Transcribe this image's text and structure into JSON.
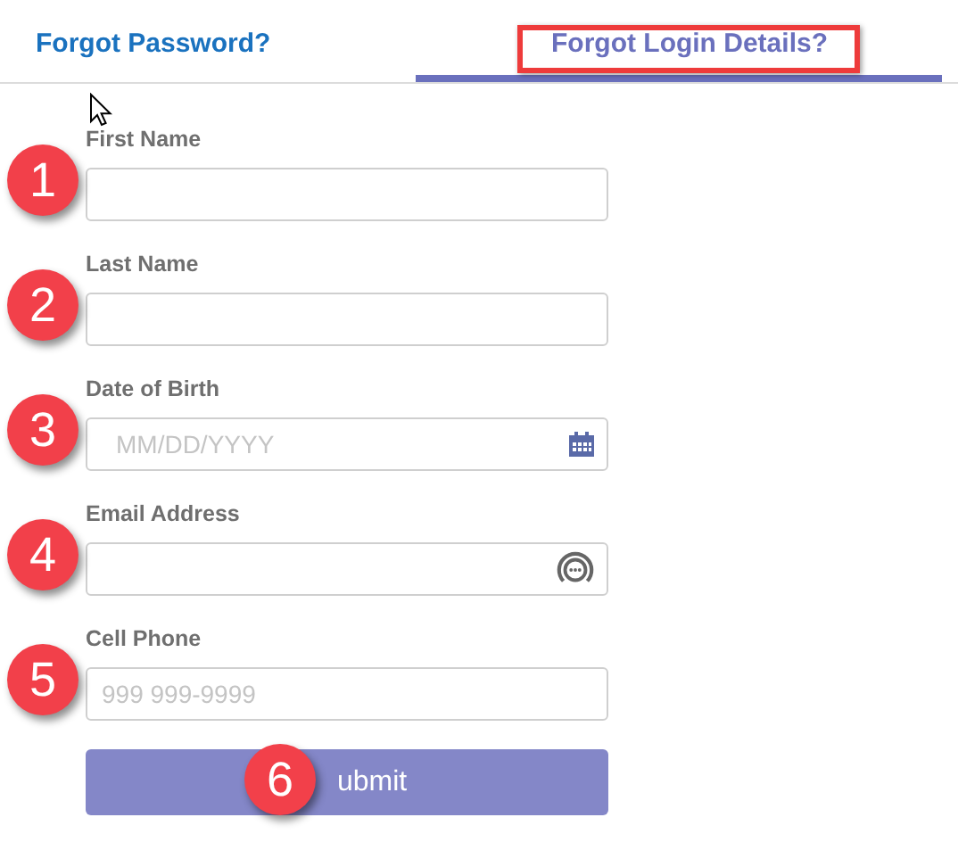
{
  "tabs": [
    {
      "label": "Forgot Password?",
      "selected": false,
      "highlighted": false
    },
    {
      "label": "Forgot Login Details?",
      "selected": true,
      "highlighted": true
    }
  ],
  "fields": [
    {
      "kind": "text",
      "label": "First Name",
      "marker": "1"
    },
    {
      "kind": "text",
      "label": "Last Name",
      "marker": "2"
    },
    {
      "kind": "date",
      "label": "Date of Birth",
      "placeholder": "MM/DD/YYYY",
      "marker": "3"
    },
    {
      "kind": "email",
      "label": "Email Address",
      "marker": "4"
    },
    {
      "kind": "phone",
      "label": "Cell Phone",
      "placeholder": "999 999-9999",
      "marker": "5"
    }
  ],
  "submit_button": {
    "label": "ubmit",
    "marker": "6"
  }
}
